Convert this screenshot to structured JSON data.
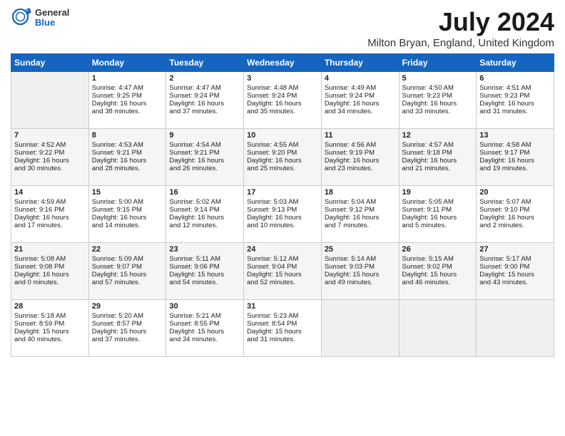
{
  "header": {
    "logo_line1": "General",
    "logo_line2": "Blue",
    "title": "July 2024",
    "subtitle": "Milton Bryan, England, United Kingdom"
  },
  "days_of_week": [
    "Sunday",
    "Monday",
    "Tuesday",
    "Wednesday",
    "Thursday",
    "Friday",
    "Saturday"
  ],
  "weeks": [
    [
      {
        "day": "",
        "data": ""
      },
      {
        "day": "1",
        "data": "Sunrise: 4:47 AM\nSunset: 9:25 PM\nDaylight: 16 hours\nand 38 minutes."
      },
      {
        "day": "2",
        "data": "Sunrise: 4:47 AM\nSunset: 9:24 PM\nDaylight: 16 hours\nand 37 minutes."
      },
      {
        "day": "3",
        "data": "Sunrise: 4:48 AM\nSunset: 9:24 PM\nDaylight: 16 hours\nand 35 minutes."
      },
      {
        "day": "4",
        "data": "Sunrise: 4:49 AM\nSunset: 9:24 PM\nDaylight: 16 hours\nand 34 minutes."
      },
      {
        "day": "5",
        "data": "Sunrise: 4:50 AM\nSunset: 9:23 PM\nDaylight: 16 hours\nand 33 minutes."
      },
      {
        "day": "6",
        "data": "Sunrise: 4:51 AM\nSunset: 9:23 PM\nDaylight: 16 hours\nand 31 minutes."
      }
    ],
    [
      {
        "day": "7",
        "data": "Sunrise: 4:52 AM\nSunset: 9:22 PM\nDaylight: 16 hours\nand 30 minutes."
      },
      {
        "day": "8",
        "data": "Sunrise: 4:53 AM\nSunset: 9:21 PM\nDaylight: 16 hours\nand 28 minutes."
      },
      {
        "day": "9",
        "data": "Sunrise: 4:54 AM\nSunset: 9:21 PM\nDaylight: 16 hours\nand 26 minutes."
      },
      {
        "day": "10",
        "data": "Sunrise: 4:55 AM\nSunset: 9:20 PM\nDaylight: 16 hours\nand 25 minutes."
      },
      {
        "day": "11",
        "data": "Sunrise: 4:56 AM\nSunset: 9:19 PM\nDaylight: 16 hours\nand 23 minutes."
      },
      {
        "day": "12",
        "data": "Sunrise: 4:57 AM\nSunset: 9:18 PM\nDaylight: 16 hours\nand 21 minutes."
      },
      {
        "day": "13",
        "data": "Sunrise: 4:58 AM\nSunset: 9:17 PM\nDaylight: 16 hours\nand 19 minutes."
      }
    ],
    [
      {
        "day": "14",
        "data": "Sunrise: 4:59 AM\nSunset: 9:16 PM\nDaylight: 16 hours\nand 17 minutes."
      },
      {
        "day": "15",
        "data": "Sunrise: 5:00 AM\nSunset: 9:15 PM\nDaylight: 16 hours\nand 14 minutes."
      },
      {
        "day": "16",
        "data": "Sunrise: 5:02 AM\nSunset: 9:14 PM\nDaylight: 16 hours\nand 12 minutes."
      },
      {
        "day": "17",
        "data": "Sunrise: 5:03 AM\nSunset: 9:13 PM\nDaylight: 16 hours\nand 10 minutes."
      },
      {
        "day": "18",
        "data": "Sunrise: 5:04 AM\nSunset: 9:12 PM\nDaylight: 16 hours\nand 7 minutes."
      },
      {
        "day": "19",
        "data": "Sunrise: 5:05 AM\nSunset: 9:11 PM\nDaylight: 16 hours\nand 5 minutes."
      },
      {
        "day": "20",
        "data": "Sunrise: 5:07 AM\nSunset: 9:10 PM\nDaylight: 16 hours\nand 2 minutes."
      }
    ],
    [
      {
        "day": "21",
        "data": "Sunrise: 5:08 AM\nSunset: 9:08 PM\nDaylight: 16 hours\nand 0 minutes."
      },
      {
        "day": "22",
        "data": "Sunrise: 5:09 AM\nSunset: 9:07 PM\nDaylight: 15 hours\nand 57 minutes."
      },
      {
        "day": "23",
        "data": "Sunrise: 5:11 AM\nSunset: 9:06 PM\nDaylight: 15 hours\nand 54 minutes."
      },
      {
        "day": "24",
        "data": "Sunrise: 5:12 AM\nSunset: 9:04 PM\nDaylight: 15 hours\nand 52 minutes."
      },
      {
        "day": "25",
        "data": "Sunrise: 5:14 AM\nSunset: 9:03 PM\nDaylight: 15 hours\nand 49 minutes."
      },
      {
        "day": "26",
        "data": "Sunrise: 5:15 AM\nSunset: 9:02 PM\nDaylight: 15 hours\nand 46 minutes."
      },
      {
        "day": "27",
        "data": "Sunrise: 5:17 AM\nSunset: 9:00 PM\nDaylight: 15 hours\nand 43 minutes."
      }
    ],
    [
      {
        "day": "28",
        "data": "Sunrise: 5:18 AM\nSunset: 8:59 PM\nDaylight: 15 hours\nand 40 minutes."
      },
      {
        "day": "29",
        "data": "Sunrise: 5:20 AM\nSunset: 8:57 PM\nDaylight: 15 hours\nand 37 minutes."
      },
      {
        "day": "30",
        "data": "Sunrise: 5:21 AM\nSunset: 8:55 PM\nDaylight: 15 hours\nand 34 minutes."
      },
      {
        "day": "31",
        "data": "Sunrise: 5:23 AM\nSunset: 8:54 PM\nDaylight: 15 hours\nand 31 minutes."
      },
      {
        "day": "",
        "data": ""
      },
      {
        "day": "",
        "data": ""
      },
      {
        "day": "",
        "data": ""
      }
    ]
  ]
}
